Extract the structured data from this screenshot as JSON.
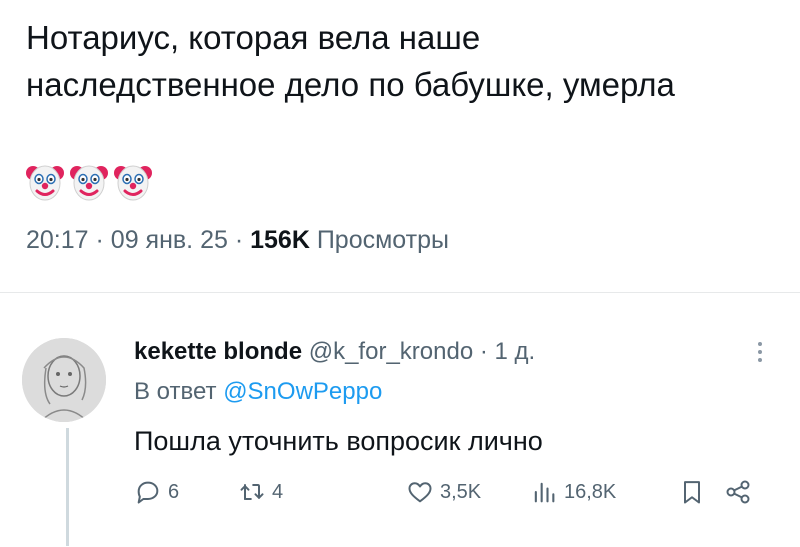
{
  "tweet": {
    "text_line1": "Нотариус, которая вела наше",
    "text_line2": "наследственное дело по бабушке, умерла",
    "emojis": [
      "clown-face",
      "clown-face",
      "clown-face"
    ],
    "time": "20:17",
    "date": "09 янв. 25",
    "separator": "·",
    "views_count": "156K",
    "views_label": "Просмотры"
  },
  "reply": {
    "author_name": "kekette blonde",
    "handle": "@k_for_krondo",
    "age": "1 д.",
    "reply_prefix": "В ответ",
    "reply_mention": "@SnOwPeppo",
    "text": "Пошла уточнить вопросик лично",
    "stats": {
      "replies": "6",
      "retweets": "4",
      "likes": "3,5K",
      "views": "16,8K"
    }
  },
  "colors": {
    "text": "#0f1419",
    "secondary": "#536471",
    "link": "#1d9bf0",
    "divider": "#e7e9ea"
  }
}
